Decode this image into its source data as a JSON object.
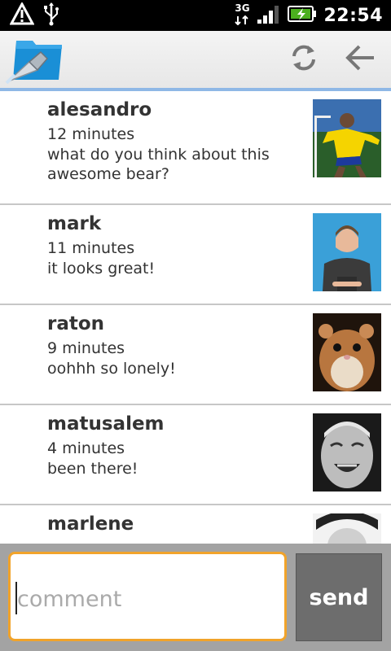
{
  "status_bar": {
    "time": "22:54",
    "network": "3G"
  },
  "messages": [
    {
      "name": "alesandro",
      "time": "12 minutes",
      "text": "what do you think about this awesome bear?",
      "avatar": "soccer-player-photo"
    },
    {
      "name": "mark",
      "time": "11 minutes",
      "text": "it looks great!",
      "avatar": "man-portrait-photo"
    },
    {
      "name": "raton",
      "time": "9 minutes",
      "text": "oohhh so lonely!",
      "avatar": "hamster-photo"
    },
    {
      "name": "matusalem",
      "time": "4 minutes",
      "text": "been there!",
      "avatar": "old-woman-photo"
    },
    {
      "name": "marlene",
      "time": "",
      "text": "",
      "avatar": "woman-photo"
    }
  ],
  "comment": {
    "placeholder": "comment",
    "send_label": "send"
  },
  "colors": {
    "accent_border": "#f1a32a",
    "actionbar_underline": "#8fb8e6",
    "send_bg": "#6d6d6d"
  }
}
